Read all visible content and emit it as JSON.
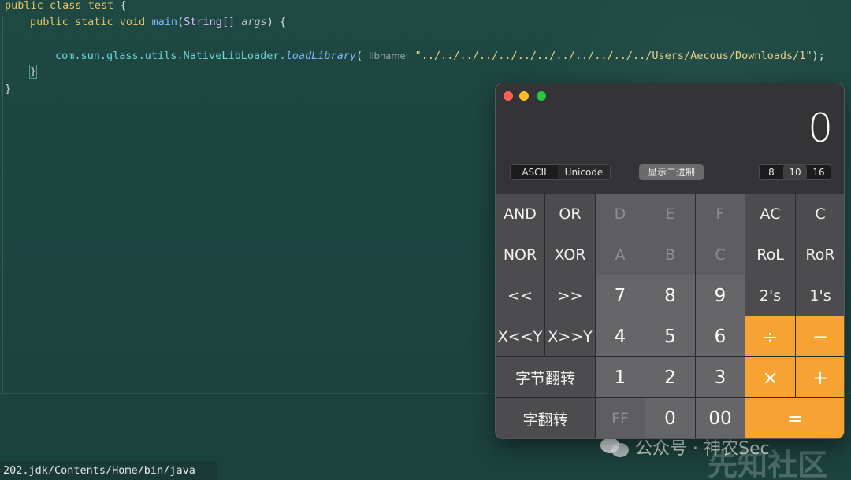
{
  "editor": {
    "line1": {
      "public": "public",
      "class": "class",
      "name": "test",
      "brace": "{"
    },
    "line2": {
      "mods": "public static void",
      "main": "main",
      "type": "String[]",
      "param": "args",
      "rest": ") {"
    },
    "line3": {
      "pkg": "com.sun.glass.utils.NativeLibLoader.",
      "method": "loadLibrary",
      "open": "(",
      "hint": "libname:",
      "arg": "\"../../../../../../../../../../../../Users/Aecous/Downloads/1\"",
      "close": ");"
    },
    "line4": "}",
    "line5": "}",
    "status_path": "202.jdk/Contents/Home/bin/java ..."
  },
  "calculator": {
    "display": "0",
    "encoding": {
      "ascii": "ASCII",
      "unicode": "Unicode"
    },
    "show_binary": "显示二进制",
    "bases": [
      "8",
      "10",
      "16"
    ],
    "selected_base": "10",
    "keys": [
      [
        "AND",
        "OR",
        "D",
        "E",
        "F",
        "AC",
        "C"
      ],
      [
        "NOR",
        "XOR",
        "A",
        "B",
        "C",
        "RoL",
        "RoR"
      ],
      [
        "<<",
        ">>",
        "7",
        "8",
        "9",
        "2's",
        "1's"
      ],
      [
        "X<<Y",
        "X>>Y",
        "4",
        "5",
        "6",
        "÷",
        "−"
      ],
      [
        "字节翻转",
        "1",
        "2",
        "3",
        "×",
        "+"
      ],
      [
        "字翻转",
        "FF",
        "0",
        "00",
        "="
      ]
    ],
    "colors": {
      "operator": "#f6a334",
      "dark_key": "#4c4c4e",
      "digit_key": "#666668"
    }
  },
  "watermark": {
    "text": "公众号 · 神农Sec",
    "big": "先知社区"
  }
}
